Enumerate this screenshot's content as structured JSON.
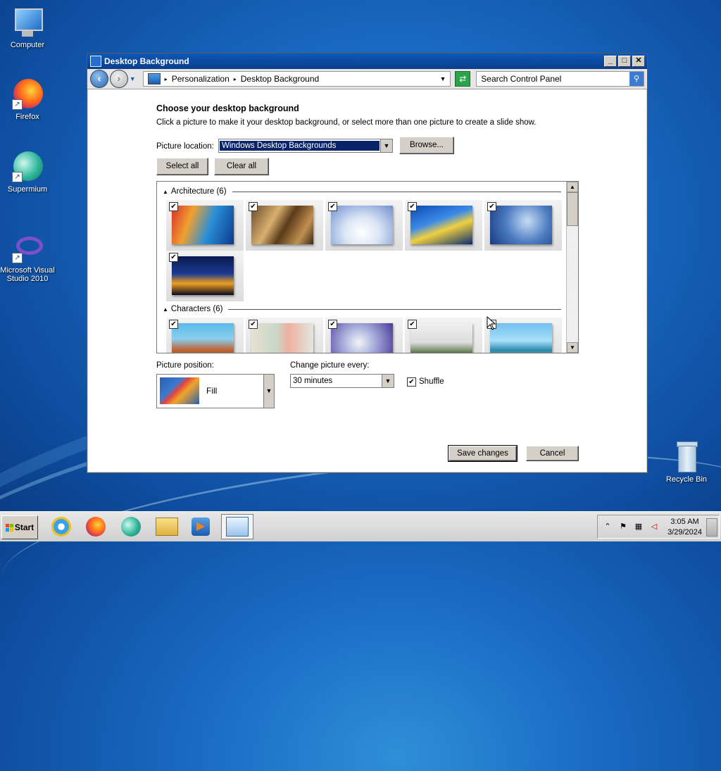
{
  "desktop": {
    "icons": [
      {
        "label": "Computer"
      },
      {
        "label": "Firefox"
      },
      {
        "label": "Supermium"
      },
      {
        "label": "Microsoft Visual Studio 2010"
      },
      {
        "label": "Recycle Bin"
      }
    ]
  },
  "window": {
    "title": "Desktop Background",
    "breadcrumb": [
      "Personalization",
      "Desktop Background"
    ],
    "search_placeholder": "Search Control Panel",
    "heading": "Choose your desktop background",
    "instructions": "Click a picture to make it your desktop background, or select more than one picture to create a slide show.",
    "picture_location_label": "Picture location:",
    "picture_location_value": "Windows Desktop Backgrounds",
    "browse_label": "Browse...",
    "select_all_label": "Select all",
    "clear_all_label": "Clear all",
    "groups": [
      {
        "name": "Architecture (6)",
        "count": 6,
        "checked": [
          true,
          true,
          true,
          true,
          true,
          true
        ]
      },
      {
        "name": "Characters (6)",
        "count": 6,
        "checked": [
          true,
          true,
          true,
          true,
          true
        ]
      }
    ],
    "picture_position_label": "Picture position:",
    "picture_position_value": "Fill",
    "change_every_label": "Change picture every:",
    "change_every_value": "30 minutes",
    "shuffle_label": "Shuffle",
    "shuffle_checked": true,
    "save_label": "Save changes",
    "cancel_label": "Cancel"
  },
  "taskbar": {
    "start_label": "Start",
    "clock_time": "3:05 AM",
    "clock_date": "3/29/2024"
  },
  "colors": {
    "accent": "#0a246a",
    "titlebar": "#0d58b8",
    "desktop": "#1a6bc4"
  }
}
